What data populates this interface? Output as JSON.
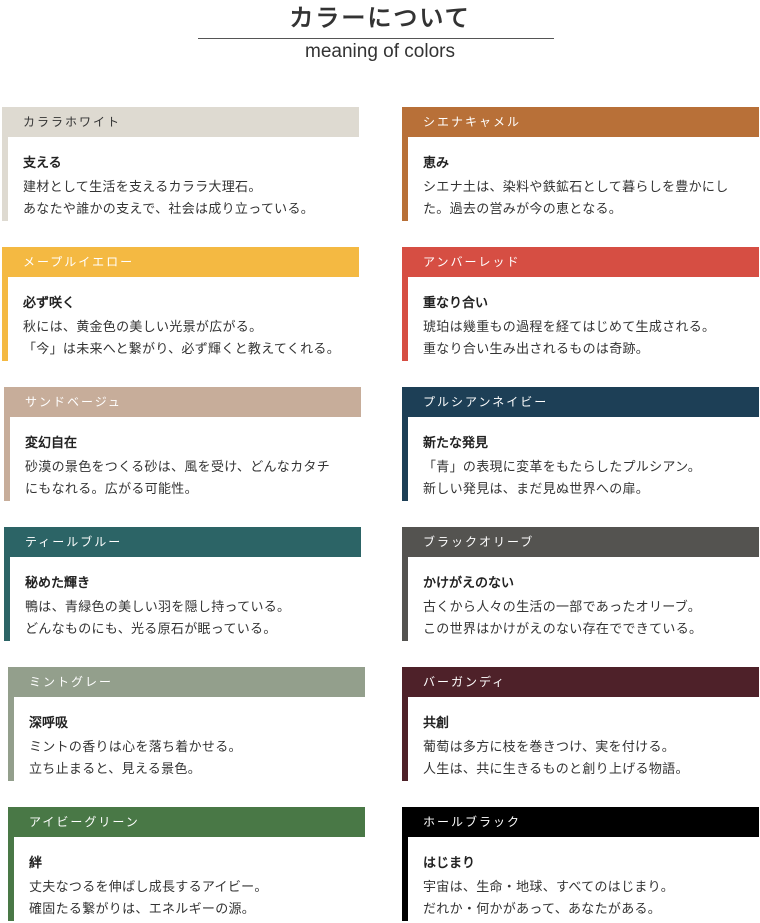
{
  "header": {
    "title": "カラーについて",
    "subtitle": "meaning of colors"
  },
  "colors": [
    {
      "name": "カララホワイト",
      "color": "#dedad1",
      "text_dark": true,
      "heading": "支える",
      "line1": "建材として生活を支えるカララ大理石。",
      "line2": "あなたや誰かの支えで、社会は成り立っている。"
    },
    {
      "name": "シエナキャメル",
      "color": "#b87038",
      "heading": "恵み",
      "line1": "シエナ土は、染料や鉄鉱石として暮らしを豊かにし",
      "line2": "た。過去の営みが今の恵となる。"
    },
    {
      "name": "メープルイエロー",
      "color": "#f4b942",
      "heading": "必ず咲く",
      "line1": "秋には、黄金色の美しい光景が広がる。",
      "line2": "「今」は未来へと繋がり、必ず輝くと教えてくれる。"
    },
    {
      "name": "アンバーレッド",
      "color": "#d64e43",
      "heading": "重なり合い",
      "line1": "琥珀は幾重もの過程を経てはじめて生成される。",
      "line2": "重なり合い生み出されるものは奇跡。"
    },
    {
      "name": "サンドベージュ",
      "color": "#c7ad9a",
      "heading": "変幻自在",
      "line1": "砂漠の景色をつくる砂は、風を受け、どんなカタチ",
      "line2": "にもなれる。広がる可能性。"
    },
    {
      "name": "プルシアンネイビー",
      "color": "#1d3f56",
      "heading": "新たな発見",
      "line1": "「青」の表現に変革をもたらしたプルシアン。",
      "line2": "新しい発見は、まだ見ぬ世界への扉。"
    },
    {
      "name": "ティールブルー",
      "color": "#2c6466",
      "heading": "秘めた輝き",
      "line1": "鴨は、青緑色の美しい羽を隠し持っている。",
      "line2": "どんなものにも、光る原石が眠っている。"
    },
    {
      "name": "ブラックオリーブ",
      "color": "#545350",
      "heading": "かけがえのない",
      "line1": "古くから人々の生活の一部であったオリーブ。",
      "line2": "この世界はかけがえのない存在でできている。"
    },
    {
      "name": "ミントグレー",
      "color": "#939f8c",
      "heading": "深呼吸",
      "line1": "ミントの香りは心を落ち着かせる。",
      "line2": "立ち止まると、見える景色。"
    },
    {
      "name": "バーガンディ",
      "color": "#4e2129",
      "heading": "共創",
      "line1": "葡萄は多方に枝を巻きつけ、実を付ける。",
      "line2": "人生は、共に生きるものと創り上げる物語。"
    },
    {
      "name": "アイビーグリーン",
      "color": "#497846",
      "heading": "絆",
      "line1": "丈夫なつるを伸ばし成長するアイビー。",
      "line2": "確固たる繋がりは、エネルギーの源。"
    },
    {
      "name": "ホールブラック",
      "color": "#000000",
      "heading": "はじまり",
      "line1": "宇宙は、生命・地球、すべてのはじまり。",
      "line2": "だれか・何かがあって、あなたがある。"
    }
  ]
}
